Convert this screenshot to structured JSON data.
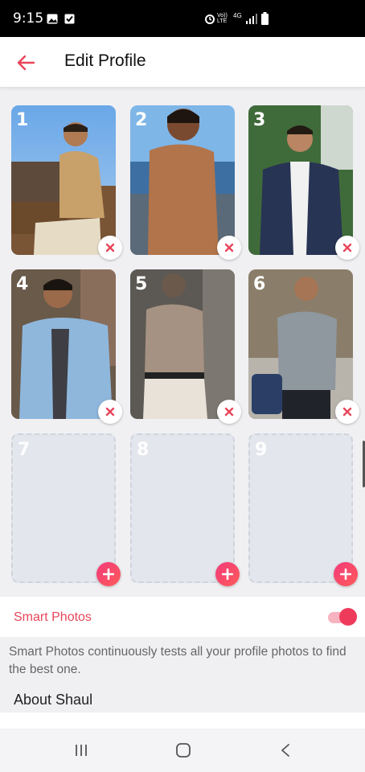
{
  "status_bar": {
    "time": "9:15",
    "network_label": "4G",
    "volte_label": "Vo)) LTE"
  },
  "header": {
    "title": "Edit Profile",
    "back_icon": "arrow-left-icon",
    "accent": "#e8455a"
  },
  "photos": [
    {
      "number": "1",
      "filled": true
    },
    {
      "number": "2",
      "filled": true
    },
    {
      "number": "3",
      "filled": true
    },
    {
      "number": "4",
      "filled": true
    },
    {
      "number": "5",
      "filled": true
    },
    {
      "number": "6",
      "filled": true
    },
    {
      "number": "7",
      "filled": false
    },
    {
      "number": "8",
      "filled": false
    },
    {
      "number": "9",
      "filled": false
    }
  ],
  "smart_photos": {
    "label": "Smart Photos",
    "enabled": true,
    "description": "Smart Photos continuously tests all your profile photos to find the best one."
  },
  "about": {
    "heading": "About Shaul"
  },
  "colors": {
    "brand_pink": "#f23a7a",
    "remove_x": "#e8455a"
  }
}
